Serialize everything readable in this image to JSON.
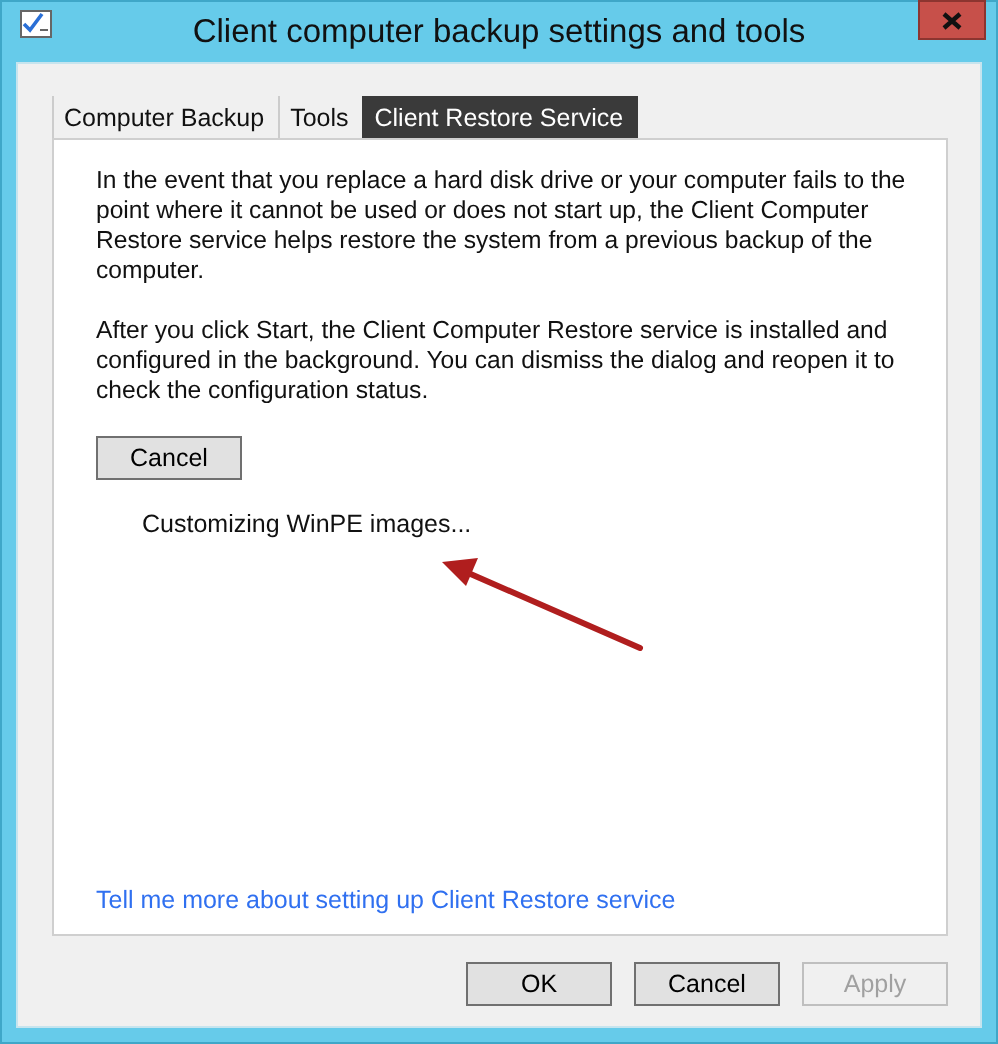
{
  "window": {
    "title": "Client computer backup settings and tools"
  },
  "tabs": [
    {
      "label": "Computer Backup",
      "selected": false
    },
    {
      "label": "Tools",
      "selected": false
    },
    {
      "label": "Client Restore Service",
      "selected": true
    }
  ],
  "panel": {
    "paragraphs": [
      "In the event that you replace a hard disk drive or your computer fails to the point where it cannot be used or does not start up, the Client Computer Restore service helps restore the system from a previous backup of the computer.",
      "After you click Start, the Client Computer Restore service is installed and configured in the background. You can dismiss the dialog and reopen it to check the configuration status."
    ],
    "action_button": "Cancel",
    "status": "Customizing WinPE images...",
    "link": "Tell me more about setting up Client Restore service"
  },
  "annotation": {
    "kind": "arrow"
  },
  "buttons": [
    {
      "label": "OK",
      "disabled": false
    },
    {
      "label": "Cancel",
      "disabled": false
    },
    {
      "label": "Apply",
      "disabled": true
    }
  ]
}
